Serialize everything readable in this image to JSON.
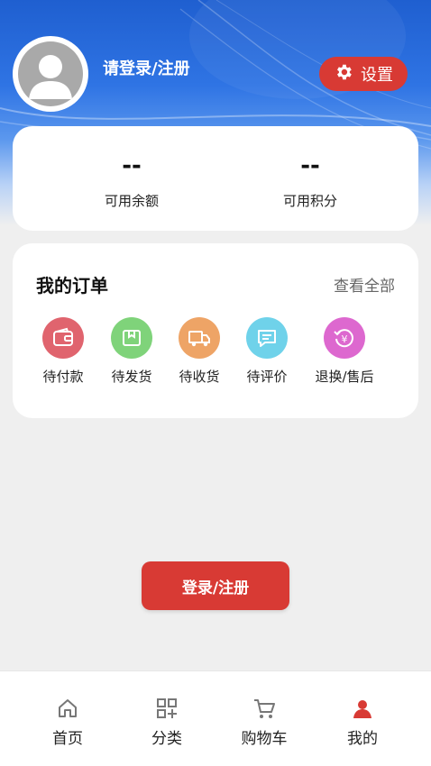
{
  "colors": {
    "accent": "#d83a34",
    "hero_blue": "#2f74e4"
  },
  "header": {
    "login_prompt": "请登录/注册",
    "settings_label": "设置"
  },
  "wallet": [
    {
      "value": "--",
      "label": "可用余额"
    },
    {
      "value": "--",
      "label": "可用积分"
    }
  ],
  "orders": {
    "title": "我的订单",
    "view_all": "查看全部",
    "items": [
      {
        "label": "待付款",
        "icon": "wallet-icon",
        "color": "#e0646e"
      },
      {
        "label": "待发货",
        "icon": "package-icon",
        "color": "#7fd37a"
      },
      {
        "label": "待收货",
        "icon": "truck-icon",
        "color": "#eea466"
      },
      {
        "label": "待评价",
        "icon": "comment-icon",
        "color": "#6fd2ea"
      },
      {
        "label": "退换/售后",
        "icon": "refund-icon",
        "color": "#dd68cf"
      }
    ]
  },
  "login_button": "登录/注册",
  "tabbar": [
    {
      "label": "首页",
      "icon": "home-icon"
    },
    {
      "label": "分类",
      "icon": "category-icon"
    },
    {
      "label": "购物车",
      "icon": "cart-icon"
    },
    {
      "label": "我的",
      "icon": "profile-icon",
      "active": true
    }
  ]
}
